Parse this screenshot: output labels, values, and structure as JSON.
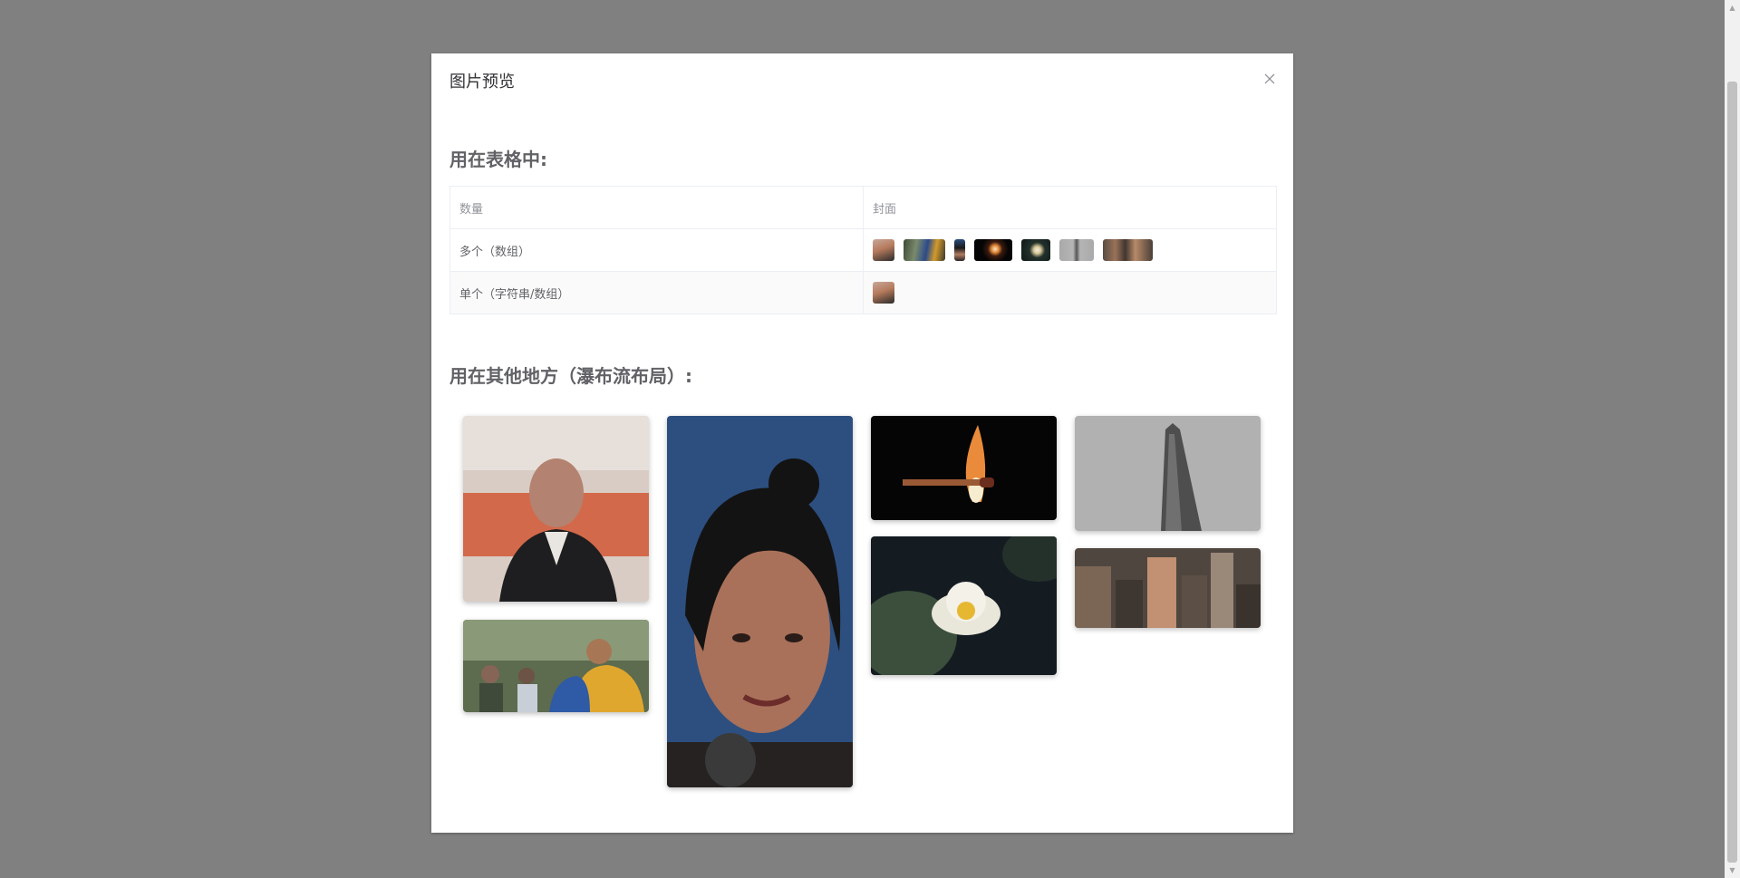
{
  "dialog": {
    "title": "图片预览",
    "close_label": "×"
  },
  "section_table": {
    "title": "用在表格中:",
    "headers": [
      "数量",
      "封面"
    ],
    "rows": [
      {
        "label": "多个（数组）"
      },
      {
        "label": "单个（字符串/数组）"
      }
    ]
  },
  "section_waterfall": {
    "title": "用在其他地方（瀑布流布局）:"
  },
  "images": [
    {
      "name": "speaker",
      "icon": "person-photo"
    },
    {
      "name": "festival",
      "icon": "crowd-photo"
    },
    {
      "name": "portrait",
      "icon": "person-photo"
    },
    {
      "name": "match",
      "icon": "flame-photo"
    },
    {
      "name": "lotus",
      "icon": "flower-photo"
    },
    {
      "name": "flatiron",
      "icon": "building-photo"
    },
    {
      "name": "city",
      "icon": "cityscape-photo"
    }
  ],
  "colors": {
    "overlay": "#808080",
    "dialog_bg": "#ffffff",
    "border": "#ebeef5"
  }
}
